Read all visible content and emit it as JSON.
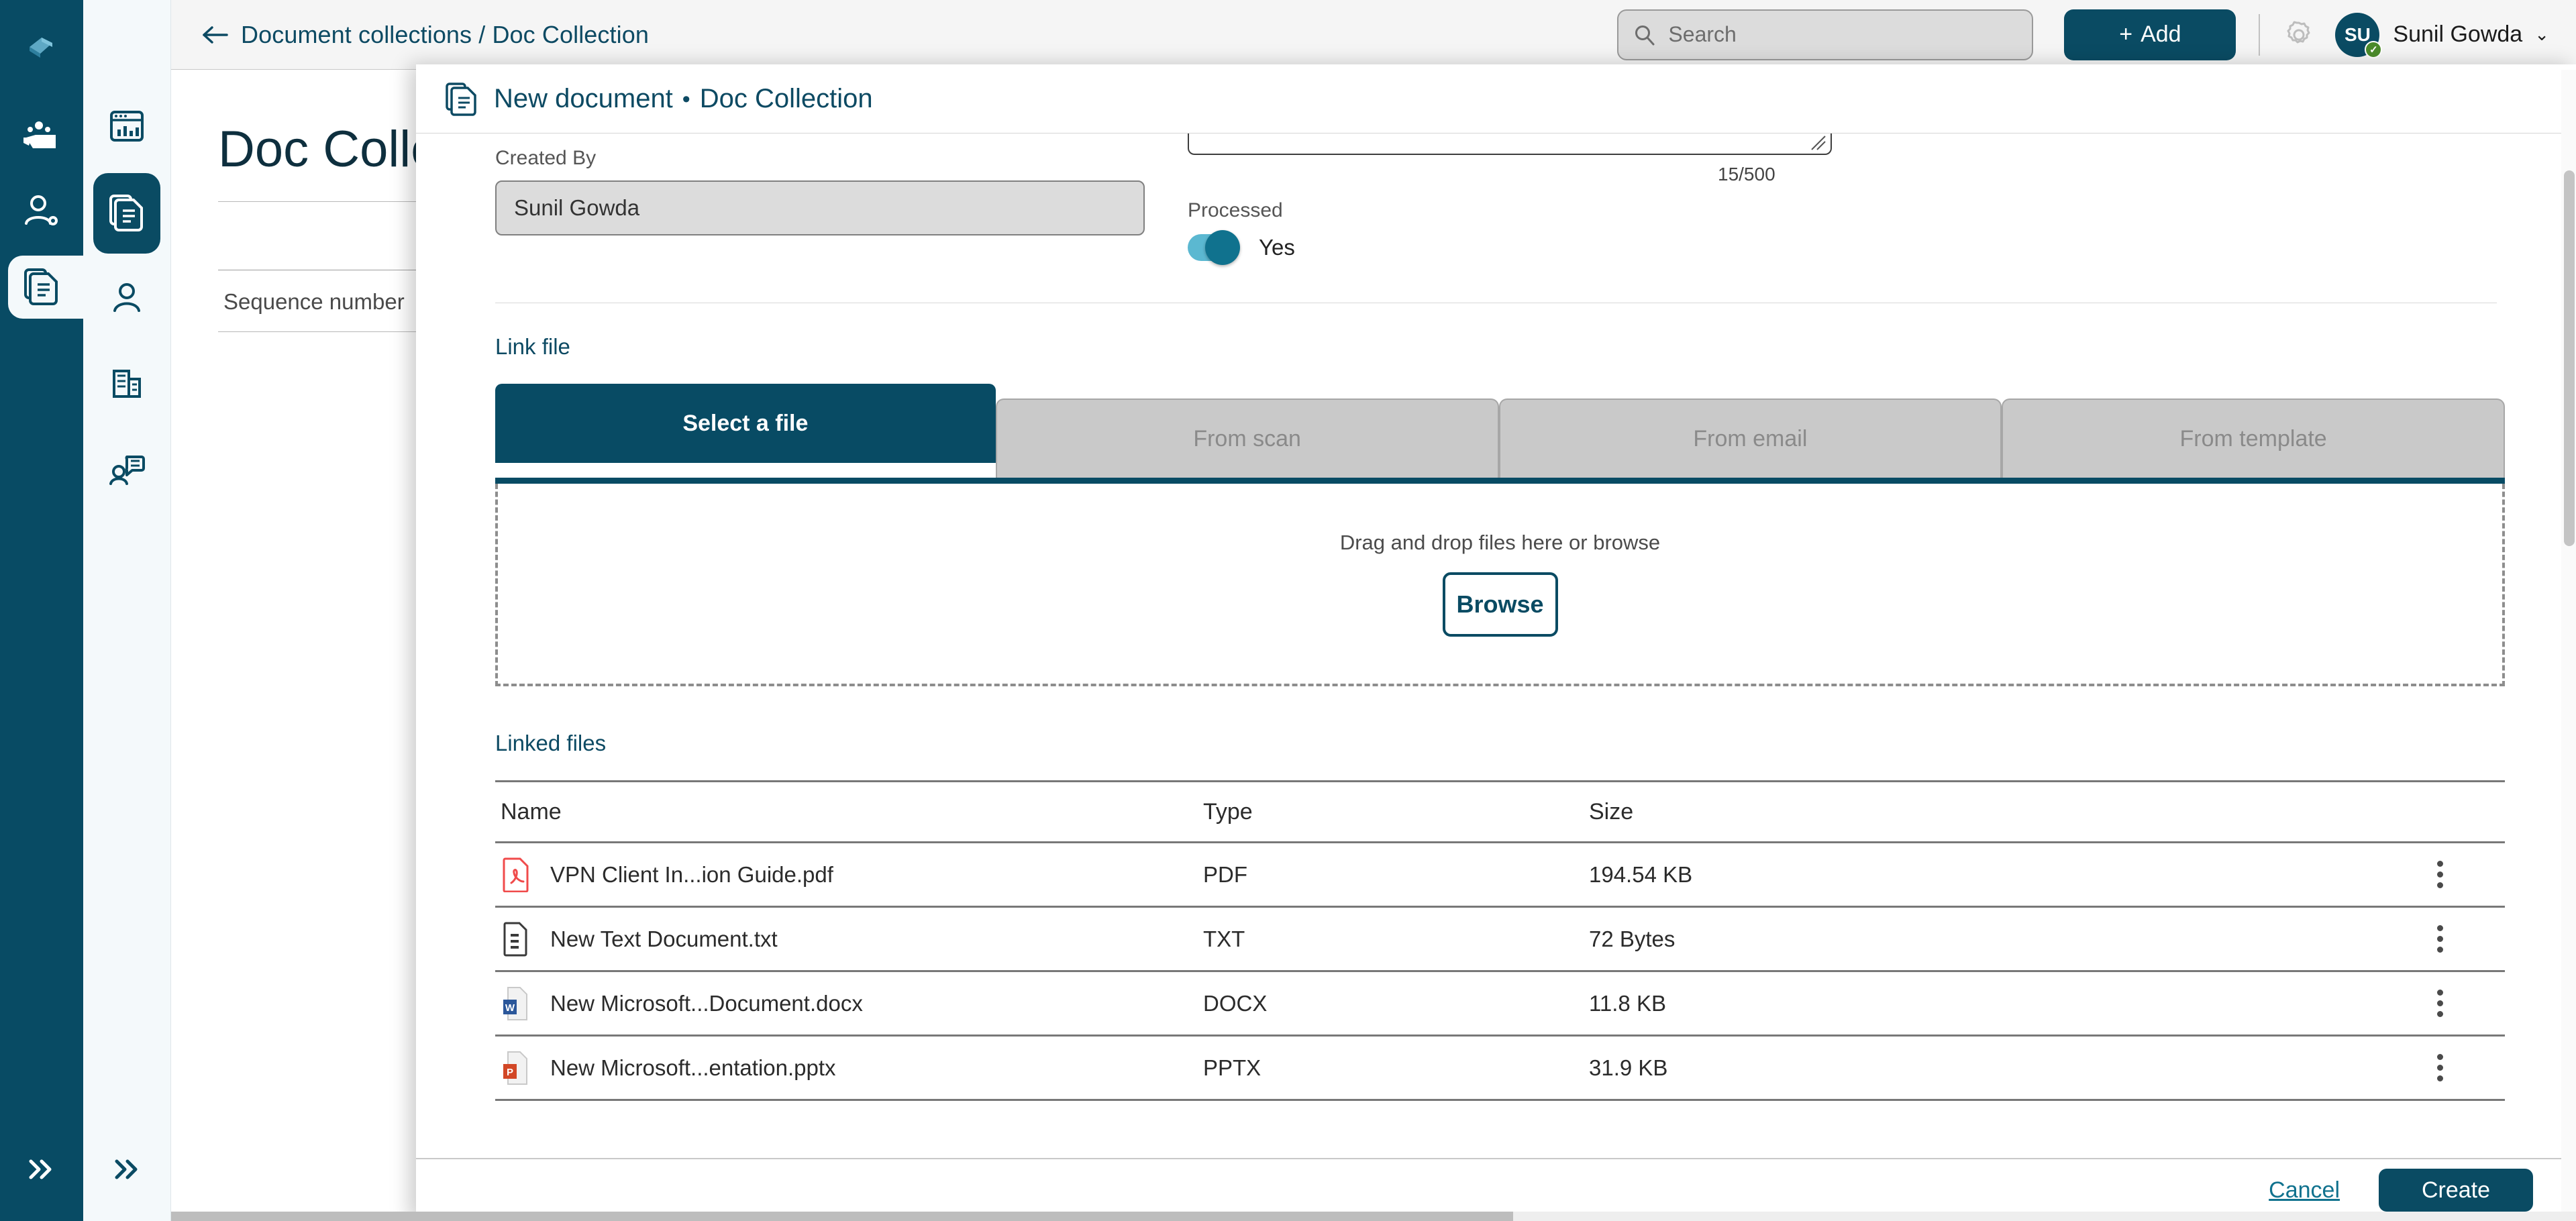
{
  "app": {
    "brand_dark": "#084B64",
    "accent": "#0A4B63",
    "link_color": "#10728E"
  },
  "topbar": {
    "back_label": "←",
    "breadcrumb": "Document collections / Doc Collection",
    "search_placeholder": "Search",
    "add_label": "Add",
    "add_plus": "+",
    "user_initials": "SU",
    "user_name": "Sunil Gowda",
    "caret": "⌄"
  },
  "sidebar_dark": {
    "logo_name": "app-logo",
    "items": [
      {
        "name": "team-folder-icon",
        "active": false
      },
      {
        "name": "user-settings-icon",
        "active": false
      },
      {
        "name": "documents-icon",
        "active": true
      }
    ],
    "expand_label": "»"
  },
  "sidebar_light": {
    "items": [
      {
        "name": "dashboard-icon",
        "active": false
      },
      {
        "name": "documents-icon",
        "active": true
      },
      {
        "name": "contact-icon",
        "active": false
      },
      {
        "name": "company-icon",
        "active": false
      },
      {
        "name": "conversation-icon",
        "active": false
      }
    ],
    "expand_label": "»"
  },
  "background_page": {
    "title": "Doc Collection",
    "column_header": "Sequence number"
  },
  "modal": {
    "icon_name": "document-icon",
    "title": "New document",
    "separator": "•",
    "subtitle": "Doc Collection",
    "form": {
      "created_by_label": "Created By",
      "created_by_value": "Sunil  Gowda",
      "char_count": "15/500",
      "processed_label": "Processed",
      "processed_value": "Yes"
    },
    "link_file": {
      "section_title": "Link file",
      "tabs": [
        {
          "label": "Select a file",
          "active": true
        },
        {
          "label": "From scan",
          "active": false
        },
        {
          "label": "From email",
          "active": false
        },
        {
          "label": "From template",
          "active": false
        }
      ],
      "dropzone_text": "Drag and drop files here or browse",
      "browse_label": "Browse"
    },
    "linked_files": {
      "section_title": "Linked files",
      "columns": [
        "Name",
        "Type",
        "Size"
      ],
      "rows": [
        {
          "icon": "pdf-file-icon",
          "name": "VPN Client In...ion Guide.pdf",
          "type": "PDF",
          "size": "194.54 KB"
        },
        {
          "icon": "txt-file-icon",
          "name": "New Text Document.txt",
          "type": "TXT",
          "size": "72 Bytes"
        },
        {
          "icon": "docx-file-icon",
          "name": "New Microsoft...Document.docx",
          "type": "DOCX",
          "size": "11.8 KB"
        },
        {
          "icon": "pptx-file-icon",
          "name": "New Microsoft...entation.pptx",
          "type": "PPTX",
          "size": "31.9 KB"
        }
      ],
      "row_menu_label": "⋮"
    },
    "footer": {
      "cancel_label": "Cancel",
      "create_label": "Create"
    }
  }
}
